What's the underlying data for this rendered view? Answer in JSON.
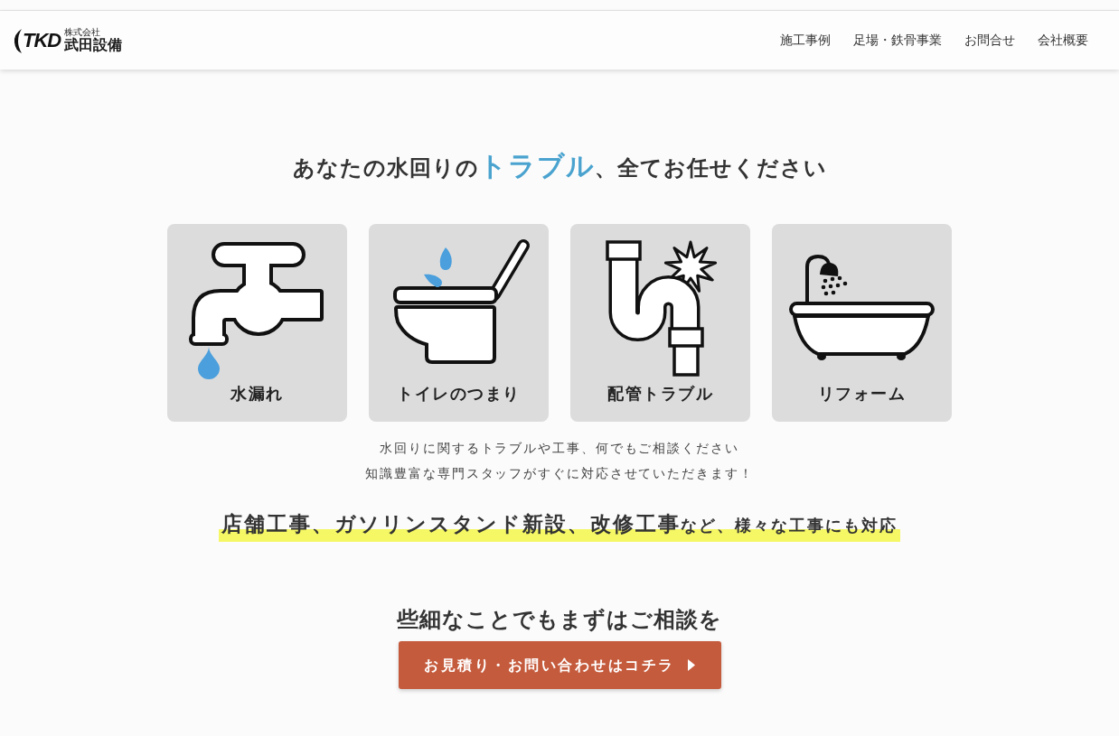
{
  "header": {
    "logo": {
      "mark": "TKD",
      "company_type": "株式会社",
      "name": "武田設備"
    },
    "nav": [
      "施工事例",
      "足場・鉄骨事業",
      "お問合せ",
      "会社概要"
    ]
  },
  "hero": {
    "heading": {
      "before": "あなたの水回りの",
      "accent": "トラブル",
      "after": "、全てお任せください"
    }
  },
  "services": [
    {
      "kind": "faucet",
      "label": "水漏れ"
    },
    {
      "kind": "toilet",
      "label": "トイレのつまり"
    },
    {
      "kind": "pipe",
      "label": "配管トラブル"
    },
    {
      "kind": "bathtub",
      "label": "リフォーム"
    }
  ],
  "intro": [
    "水回りに関するトラブルや工事、何でもご相談ください",
    "知識豊富な専門スタッフがすぐに対応させていただきます！"
  ],
  "highlight": {
    "main": "店舗工事、ガソリンスタンド新設、改修工事",
    "rest": "など、様々な工事にも対応"
  },
  "cta": {
    "heading": "些細なことでもまずはご相談を",
    "button": "お見積り・お問い合わせはコチラ"
  }
}
